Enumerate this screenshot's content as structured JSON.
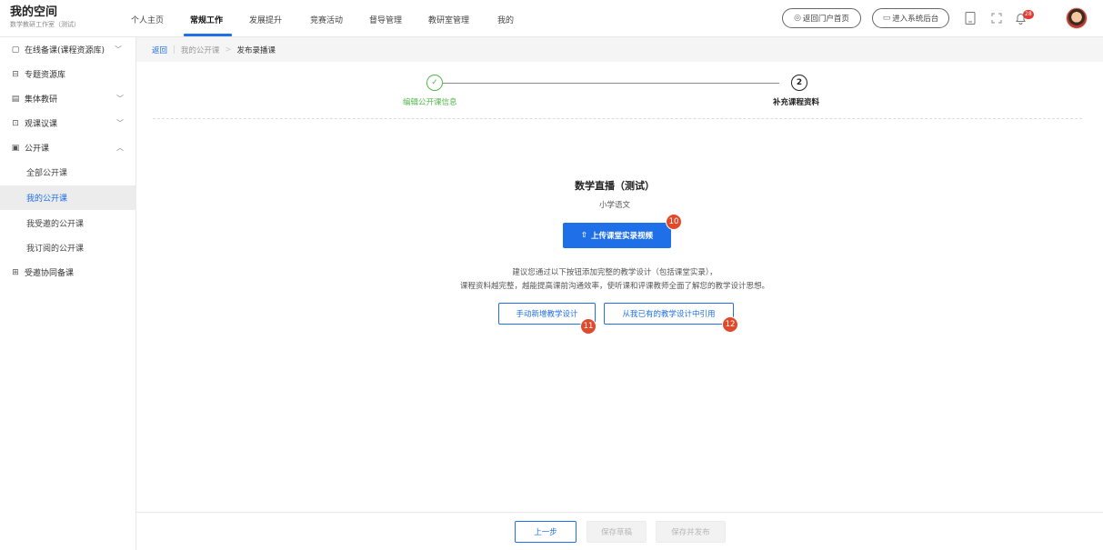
{
  "brand": {
    "title": "我的空间",
    "subtitle": "数学教研工作室（测试）"
  },
  "nav": {
    "items": [
      "个人主页",
      "常规工作",
      "发展提升",
      "竞赛活动",
      "督导管理",
      "教研室管理",
      "我的"
    ],
    "active_index": 1
  },
  "header": {
    "portal_button": "返回门户首页",
    "admin_button": "进入系统后台",
    "notification_count": "28"
  },
  "sidebar": {
    "items": [
      {
        "label": "在线备课(课程资源库)",
        "icon": "document-icon",
        "chevron": "down"
      },
      {
        "label": "专题资源库",
        "icon": "folder-icon"
      },
      {
        "label": "集体教研",
        "icon": "group-icon",
        "chevron": "down"
      },
      {
        "label": "观课议课",
        "icon": "observe-icon",
        "chevron": "down"
      },
      {
        "label": "公开课",
        "icon": "open-class-icon",
        "chevron": "up"
      },
      {
        "label": "全部公开课",
        "sub": true
      },
      {
        "label": "我的公开课",
        "sub": true,
        "active": true
      },
      {
        "label": "我受邀的公开课",
        "sub": true
      },
      {
        "label": "我订阅的公开课",
        "sub": true
      },
      {
        "label": "受邀协同备课",
        "icon": "collab-icon"
      }
    ]
  },
  "breadcrumb": {
    "back": "返回",
    "parent": "我的公开课",
    "separator": ">",
    "current": "发布录播课"
  },
  "steps": [
    {
      "number": "✓",
      "label": "编辑公开课信息",
      "status": "done"
    },
    {
      "number": "2",
      "label": "补充课程资料",
      "status": "current"
    }
  ],
  "content": {
    "course_title": "数学直播（测试）",
    "course_subject": "小学语文",
    "upload_button": "上传课堂实录视频",
    "hint_line1": "建议您通过以下按钮添加完整的教学设计（包括课堂实录），",
    "hint_line2": "课程资料越完整，越能提高课前沟通效率，使听课和评课教师全面了解您的教学设计思想。",
    "manual_add_button": "手动新增教学设计",
    "quote_button": "从我已有的教学设计中引用"
  },
  "badges": {
    "upload": "10",
    "manual": "11",
    "quote": "12"
  },
  "footer": {
    "prev": "上一步",
    "save_draft": "保存草稿",
    "save_publish": "保存并发布"
  },
  "colors": {
    "primary": "#1f6fe8",
    "success": "#52b94a",
    "badge": "#e04a2a"
  }
}
